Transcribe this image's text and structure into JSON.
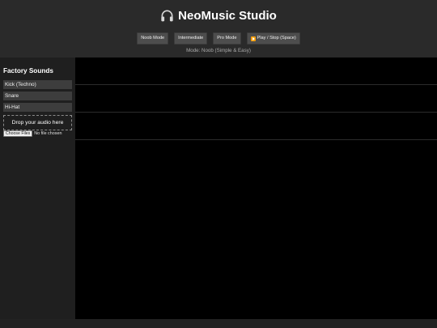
{
  "header": {
    "title": "NeoMusic Studio",
    "title_icon": "headphones-icon",
    "buttons": {
      "noob": "Noob Mode",
      "intermediate": "Intermediate",
      "pro": "Pro Mode",
      "play": "Play / Stop (Space)"
    },
    "mode_status": "Mode: Noob (Simple & Easy)"
  },
  "sidebar": {
    "title": "Factory Sounds",
    "sounds": [
      "Kick (Techno)",
      "Snare",
      "Hi-Hat"
    ],
    "drop_zone": "Drop your audio here",
    "file_input": {
      "button": "Choose Files",
      "status": "No file chosen"
    }
  },
  "colors": {
    "play_icon": "#f59e0b",
    "timeline_bg": "#000000",
    "panel_bg": "#2a2a2a"
  }
}
